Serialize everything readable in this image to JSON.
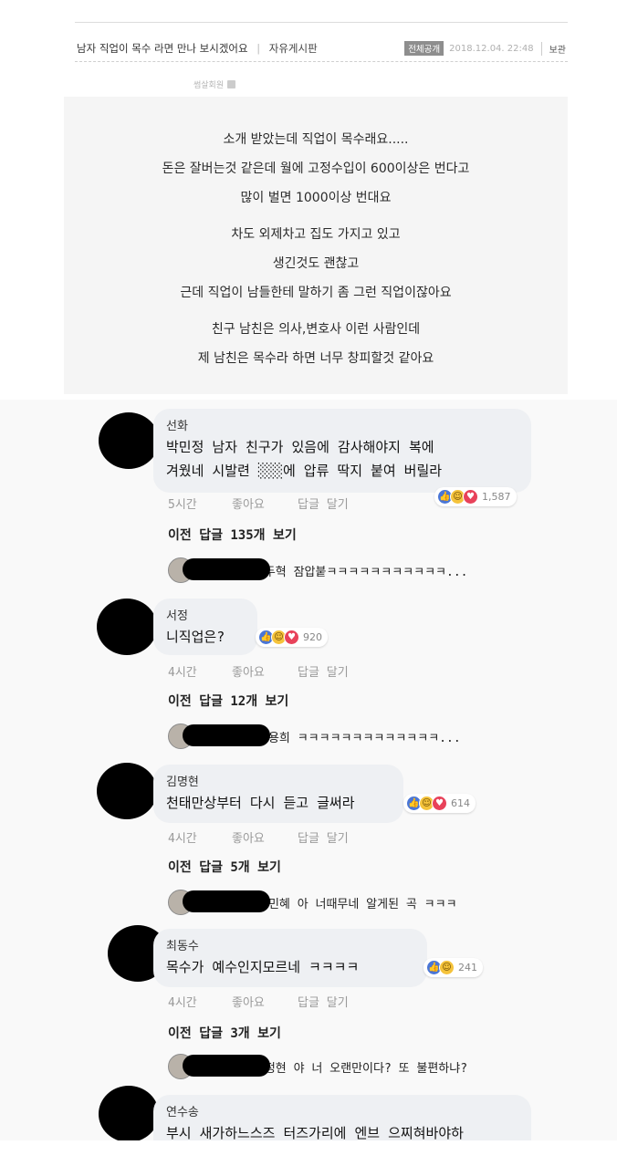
{
  "post": {
    "title": "남자 직업이 목수 라면 만나 보시겠어요",
    "board": "자유게시판",
    "badge": "전체공개",
    "date": "2018.12.04. 22:48",
    "reply_label": "보관",
    "author": "썸살회원"
  },
  "body_lines": [
    "소개 받았는데 직업이 목수래요.....",
    "돈은 잘버는것 같은데 월에 고정수입이 600이상은 번다고",
    "많이 벌면 1000이상 번대요",
    "차도 외제차고 집도 가지고 있고",
    "생긴것도 괜찮고",
    "근데 직업이 남들한테 말하기 좀 그런 직업이잖아요",
    "친구 남친은 의사,변호사 이런 사람인데",
    "제 남친은 목수라 하면 너무 창피할것 같아요"
  ],
  "comments": [
    {
      "name": "선화",
      "text_lines": [
        "박민정 남자 친구가 있음에 감사해야지 복에",
        "겨웠네 시발련 ░░░에 압류 딱지 붙여 버릴라"
      ],
      "reactions": [
        "like",
        "haha",
        "love"
      ],
      "reaction_count": "1,587",
      "time": "5시간",
      "like_label": "좋아요",
      "reply_label": "답글 달기",
      "view_replies": "이전 답글 135개 보기",
      "reply_text": "1두혁 잠압붙ㅋㅋㅋㅋㅋㅋㅋㅋㅋㅋㅋ..."
    },
    {
      "name": "서정",
      "text_lines": [
        "니직업은?"
      ],
      "reactions": [
        "like",
        "haha",
        "love"
      ],
      "reaction_count": "920",
      "time": "4시간",
      "like_label": "좋아요",
      "reply_label": "답글 달기",
      "view_replies": "이전 답글 12개 보기",
      "reply_text": "김용희 ㅋㅋㅋㅋㅋㅋㅋㅋㅋㅋㅋㅋㅋ..."
    },
    {
      "name": "김명현",
      "text_lines": [
        "천태만상부터 다시 듣고 글써라"
      ],
      "reactions": [
        "like",
        "haha",
        "love"
      ],
      "reaction_count": "614",
      "time": "4시간",
      "like_label": "좋아요",
      "reply_label": "답글 달기",
      "view_replies": "이전 답글 5개 보기",
      "reply_text": "하민혜 아 너때무네 알게된 곡 ㅋㅋㅋ"
    },
    {
      "name": "최동수",
      "text_lines": [
        "목수가 예수인지모르네 ㅋㅋㅋㅋ"
      ],
      "reactions": [
        "like",
        "haha"
      ],
      "reaction_count": "241",
      "time": "4시간",
      "like_label": "좋아요",
      "reply_label": "답글 달기",
      "view_replies": "이전 답글 3개 보기",
      "reply_text": "1정현 야 너 오랜만이다? 또 불편하냐?"
    },
    {
      "name": "연수송",
      "text_lines": [
        "부시 새가하느스즈 터즈가리에 엔브 으찌혀바야하"
      ]
    }
  ],
  "colors": {
    "bubble": "#eef0f3",
    "like": "#4a76d6",
    "haha": "#f5c33b",
    "love": "#e8425a",
    "meta": "#9a9a9a"
  }
}
